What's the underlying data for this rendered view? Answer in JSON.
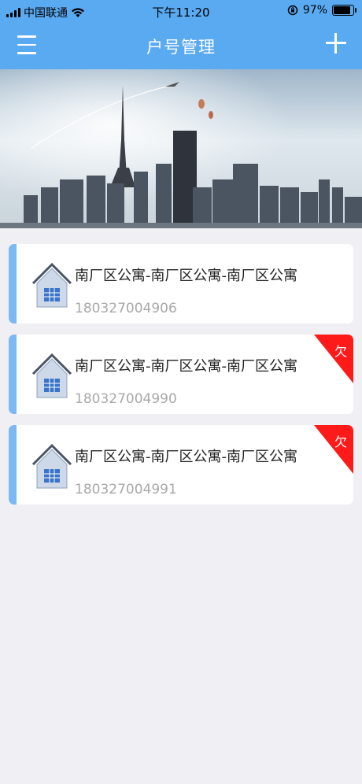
{
  "status_bar": {
    "carrier": "中国联通",
    "time": "下午11:20",
    "battery_percent": "97%",
    "battery_level": 0.97
  },
  "nav": {
    "title": "户号管理",
    "menu_icon": "menu-icon",
    "add_icon": "plus-icon"
  },
  "accounts": [
    {
      "name": "南厂区公寓-南厂区公寓-南厂区公寓",
      "number": "180327004906",
      "owe_badge": ""
    },
    {
      "name": "南厂区公寓-南厂区公寓-南厂区公寓",
      "number": "180327004990",
      "owe_badge": "欠"
    },
    {
      "name": "南厂区公寓-南厂区公寓-南厂区公寓",
      "number": "180327004991",
      "owe_badge": "欠"
    }
  ],
  "colors": {
    "header": "#5aaaf2",
    "card_accent": "#7cb8f4",
    "owe_badge": "#ff1a1a"
  }
}
